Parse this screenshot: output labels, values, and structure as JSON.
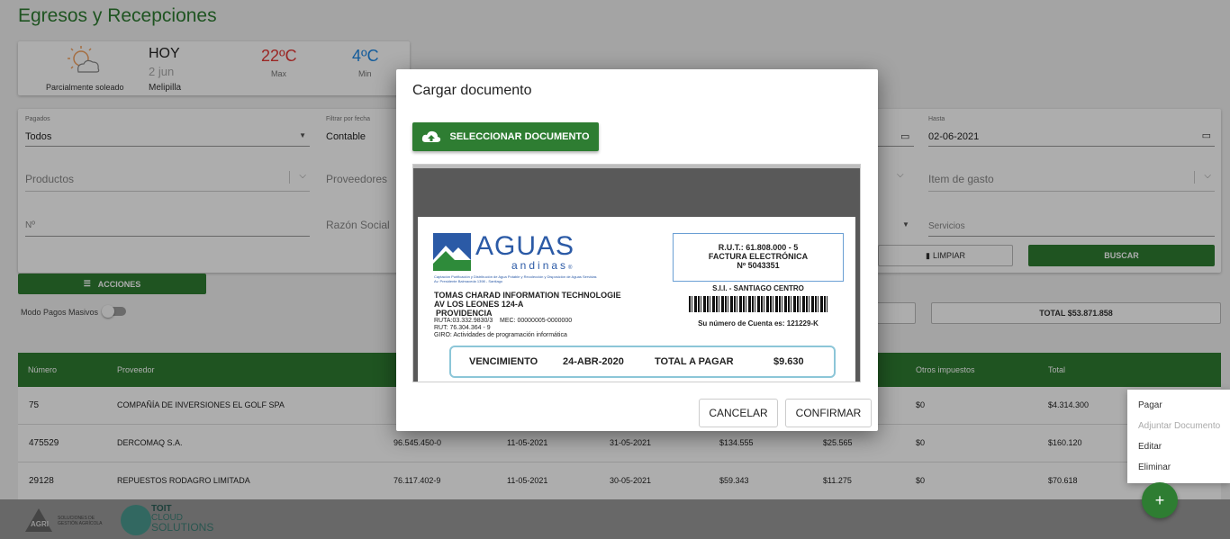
{
  "page": {
    "title": "Egresos y Recepciones"
  },
  "weather": {
    "condition": "Parcialmente soleado",
    "day": "HOY",
    "date": "2 jun",
    "city": "Melipilla",
    "max": "22ºC",
    "max_label": "Max",
    "min": "4ºC",
    "min_label": "Min"
  },
  "filters": {
    "pagados_label": "Pagados",
    "pagados_value": "Todos",
    "filtrar_label": "Filtrar por fecha",
    "filtrar_value": "Contable",
    "hasta_label": "Hasta",
    "hasta_value": "02-06-2021",
    "productos": "Productos",
    "proveedores": "Proveedores",
    "item_gasto": "Item de gasto",
    "numero": "Nº",
    "razon_social": "Razón Social",
    "servicios": "Servicios",
    "limpiar": "LIMPIAR",
    "buscar": "BUSCAR"
  },
  "actions": {
    "acciones": "ACCIONES",
    "modo_pagos": "Modo Pagos Masivos",
    "total": "TOTAL $53.871.858"
  },
  "table": {
    "headers": [
      "Número",
      "Proveedor",
      "Otros impuestos",
      "Total"
    ],
    "rows": [
      {
        "numero": "75",
        "proveedor": "COMPAÑÍA DE INVERSIONES EL GOLF SPA",
        "rut": "",
        "fecha1": "",
        "fecha2": "",
        "neto": "",
        "iva": "",
        "otros": "$0",
        "total": "$4.314.300"
      },
      {
        "numero": "475529",
        "proveedor": "DERCOMAQ S.A.",
        "rut": "96.545.450-0",
        "fecha1": "11-05-2021",
        "fecha2": "31-05-2021",
        "neto": "$134.555",
        "iva": "$25.565",
        "otros": "$0",
        "total": "$160.120"
      },
      {
        "numero": "29128",
        "proveedor": "REPUESTOS RODAGRO LIMITADA",
        "rut": "76.117.402-9",
        "fecha1": "11-05-2021",
        "fecha2": "30-05-2021",
        "neto": "$59.343",
        "iva": "$11.275",
        "otros": "$0",
        "total": "$70.618"
      }
    ]
  },
  "menu": {
    "items": [
      "Pagar",
      "Adjuntar Documento",
      "Editar",
      "Eliminar"
    ]
  },
  "footer": {
    "agri_line1": "SOLUCIONES DE",
    "agri_line2": "GESTIÓN AGRÍCOLA",
    "agri_mark": "AGRI",
    "toit": "TOIT",
    "cloud": "CLOUD",
    "solutions": "SOLUTIONS"
  },
  "dialog": {
    "title": "Cargar documento",
    "select_button": "SELECCIONAR DOCUMENTO",
    "cancel": "CANCELAR",
    "confirm": "CONFIRMAR"
  },
  "invoice": {
    "brand": "AGUAS",
    "brand_sub": "andinas",
    "brand_reg": "®",
    "fine1": "Captación Purificación y Distribución de Agua Potable y Recolección y Disposición de Aguas Servidas",
    "fine2": "Av. Presidente Balmaceda 1398 - Santiago",
    "customer": "TOMAS CHARAD INFORMATION TECHNOLOGIE",
    "address": "AV LOS LEONES 124-A",
    "comuna": "PROVIDENCIA",
    "ruta": "RUTA:03.332.9830/3",
    "mec": "MEC: 00000005-0000000",
    "rut_cliente": "RUT: 76.304.364 - 9",
    "giro": "GIRO: Actividades de programación informática",
    "rut_emisor": "R.U.T.: 61.808.000 - 5",
    "doc_type": "FACTURA ELECTRÓNICA",
    "doc_num": "Nº 5043351",
    "sii": "S.I.I. - SANTIAGO CENTRO",
    "cuenta": "Su número de Cuenta es: 121229-K",
    "venc_label": "VENCIMIENTO",
    "venc_date": "24-ABR-2020",
    "total_label": "TOTAL A PAGAR",
    "total_value": "$9.630"
  }
}
